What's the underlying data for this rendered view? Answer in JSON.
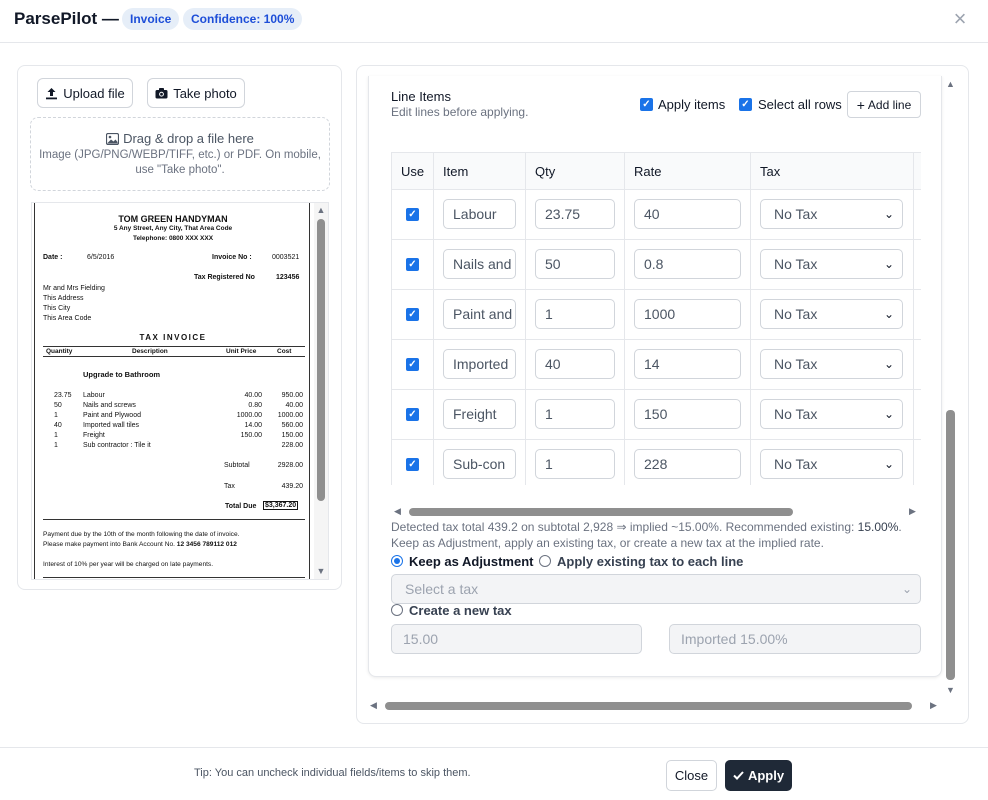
{
  "header": {
    "title": "ParsePilot —",
    "doc_type": "Invoice",
    "confidence": "Confidence: 100%",
    "close_label": "×"
  },
  "upload": {
    "upload_label": "Upload file",
    "photo_label": "Take photo",
    "drop_title": "Drag & drop a file here",
    "drop_help": "Image (JPG/PNG/WEBP/TIFF, etc.) or PDF. On mobile, use \"Take photo\"."
  },
  "invoice": {
    "company": "TOM GREEN HANDYMAN",
    "address": "5 Any Street, Any City, That Area Code",
    "telephone": "Telephone: 0800 XXX XXX",
    "date_label": "Date :",
    "date": "6/5/2016",
    "invoice_no_label": "Invoice No :",
    "invoice_no": "0003521",
    "tax_reg_label": "Tax Registered No",
    "tax_reg_no": "123456",
    "customer": [
      "Mr and Mrs Fielding",
      "This Address",
      "This City",
      "This Area Code"
    ],
    "heading": "TAX INVOICE",
    "columns": [
      "Quantity",
      "Description",
      "Unit Price",
      "Cost"
    ],
    "section": "Upgrade to Bathroom",
    "lines": [
      {
        "qty": "23.75",
        "desc": "Labour",
        "price": "40.00",
        "cost": "950.00"
      },
      {
        "qty": "50",
        "desc": "Nails and screws",
        "price": "0.80",
        "cost": "40.00"
      },
      {
        "qty": "1",
        "desc": "Paint and Plywood",
        "price": "1000.00",
        "cost": "1000.00"
      },
      {
        "qty": "40",
        "desc": "Imported wall tiles",
        "price": "14.00",
        "cost": "560.00"
      },
      {
        "qty": "1",
        "desc": "Freight",
        "price": "150.00",
        "cost": "150.00"
      },
      {
        "qty": "1",
        "desc": "Sub contractor : Tile it",
        "price": "",
        "cost": "228.00"
      }
    ],
    "subtotal_label": "Subtotal",
    "subtotal": "2928.00",
    "tax_label": "Tax",
    "tax": "439.20",
    "total_label": "Total Due",
    "total": "$3,367.20",
    "payment_1": "Payment due by the 10th of the month following the date of invoice.",
    "payment_2_prefix": "Please make payment into Bank Account No.",
    "bank_account": "12 3456 789112 012",
    "interest": "Interest of 10% per year will be charged on late payments."
  },
  "line_items": {
    "title": "Line Items",
    "subtitle": "Edit lines before applying.",
    "apply_items_label": "Apply items",
    "select_all_label": "Select all rows",
    "add_line_label": "Add line",
    "columns": [
      "Use",
      "Item",
      "Qty",
      "Rate",
      "Tax"
    ],
    "rows": [
      {
        "item": "Labour",
        "qty": "23.75",
        "rate": "40",
        "tax": "No Tax"
      },
      {
        "item": "Nails and",
        "qty": "50",
        "rate": "0.8",
        "tax": "No Tax"
      },
      {
        "item": "Paint and",
        "qty": "1",
        "rate": "1000",
        "tax": "No Tax"
      },
      {
        "item": "Imported",
        "qty": "40",
        "rate": "14",
        "tax": "No Tax"
      },
      {
        "item": "Freight",
        "qty": "1",
        "rate": "150",
        "tax": "No Tax"
      },
      {
        "item": "Sub-con",
        "qty": "1",
        "rate": "228",
        "tax": "No Tax"
      }
    ]
  },
  "tax_detect": {
    "line1_prefix": "Detected tax total 439.2 on subtotal 2,928 ⇒ implied ~15.00%. Recommended existing: ",
    "recommended": "15.00%",
    "line1_suffix": ".",
    "line2": "Keep as Adjustment, apply an existing tax, or create a new tax at the implied rate.",
    "keep_adjustment_label": "Keep as Adjustment",
    "apply_existing_label": "Apply existing tax to each line",
    "select_tax_placeholder": "Select a tax",
    "create_new_label": "Create a new tax",
    "new_tax_rate": "15.00",
    "new_tax_name": "Imported 15.00%"
  },
  "footer": {
    "tip": "Tip: You can uncheck individual fields/items to skip them.",
    "close_label": "Close",
    "apply_label": "Apply"
  },
  "colors": {
    "accent": "#1a73e8",
    "chip_bg": "#e6eef8",
    "chip_text": "#1d4ed8",
    "apply_bg": "#1f2937"
  }
}
